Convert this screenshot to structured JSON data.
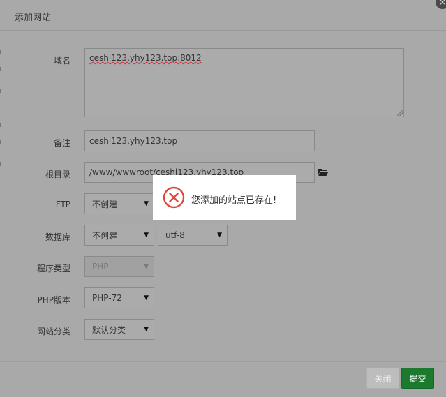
{
  "dialog": {
    "title": "添加网站",
    "close_glyph": "×"
  },
  "form": {
    "domain": {
      "label": "域名",
      "value": "ceshi123.yhy123.top:8012"
    },
    "remark": {
      "label": "备注",
      "value": "ceshi123.yhy123.top"
    },
    "root_dir": {
      "label": "根目录",
      "value": "/www/wwwroot/ceshi123.yhy123.top"
    },
    "ftp": {
      "label": "FTP",
      "selected": "不创建"
    },
    "database": {
      "label": "数据库",
      "selected": "不创建",
      "charset": "utf-8"
    },
    "program_type": {
      "label": "程序类型",
      "selected": "PHP"
    },
    "php_version": {
      "label": "PHP版本",
      "selected": "PHP-72"
    },
    "category": {
      "label": "网站分类",
      "selected": "默认分类"
    }
  },
  "footer": {
    "close_label": "关闭",
    "submit_label": "提交"
  },
  "toast": {
    "message": "您添加的站点已存在!",
    "icon": "error-circle-icon"
  },
  "colors": {
    "overlay": "#a9a9a9",
    "submit": "#1c7a2e",
    "error_icon": "#e0483e"
  }
}
